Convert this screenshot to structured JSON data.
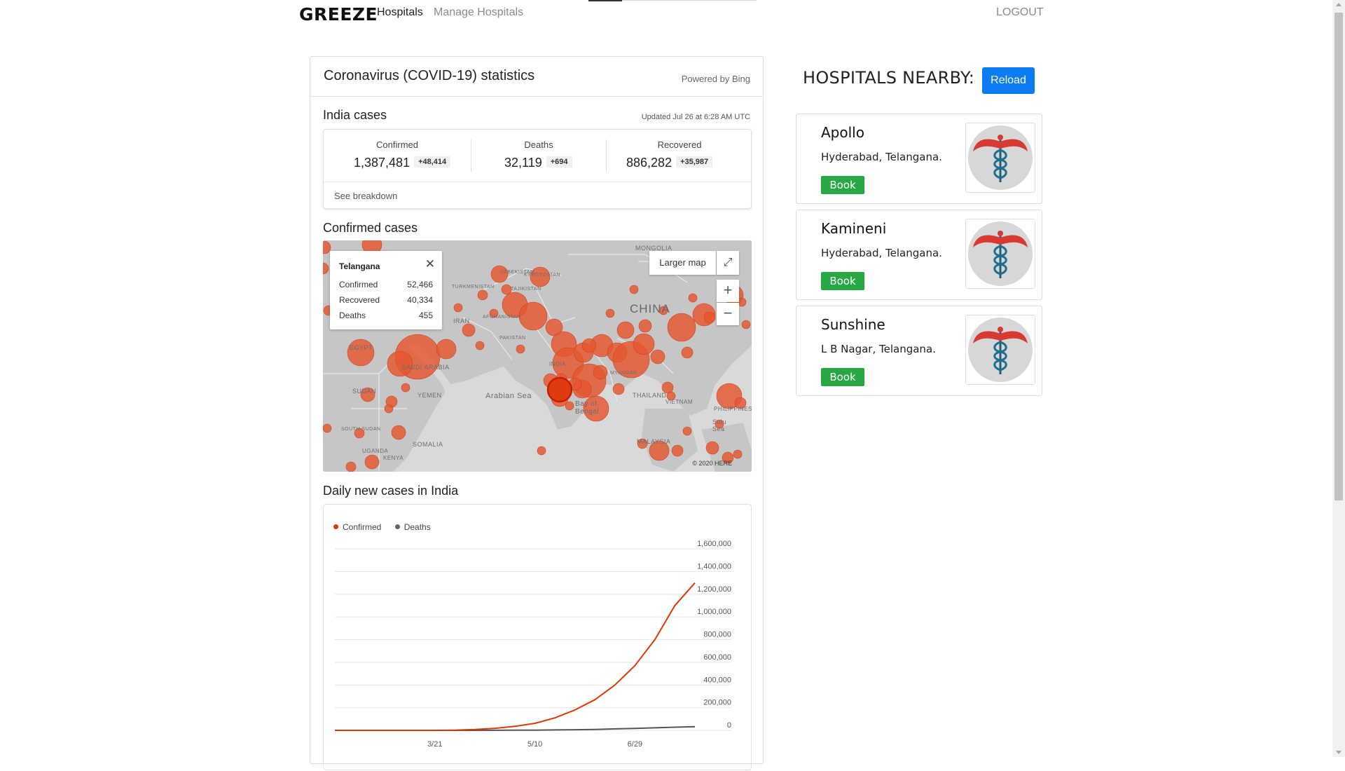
{
  "nav": {
    "brand": "GREEZE",
    "links": [
      "Hospitals",
      "Manage Hospitals"
    ],
    "logout": "LOGOUT"
  },
  "covid": {
    "title": "Coronavirus (COVID-19) statistics",
    "powered_by": "Powered by Bing",
    "india_cases_label": "India cases",
    "updated": "Updated Jul 26 at 6:28 AM UTC",
    "stats": [
      {
        "label": "Confirmed",
        "value": "1,387,481",
        "delta": "+48,414"
      },
      {
        "label": "Deaths",
        "value": "32,119",
        "delta": "+694"
      },
      {
        "label": "Recovered",
        "value": "886,282",
        "delta": "+35,987"
      }
    ],
    "see_breakdown": "See breakdown",
    "confirmed_cases_label": "Confirmed cases",
    "map": {
      "tooltip": {
        "title": "Telangana",
        "rows": [
          {
            "k": "Confirmed",
            "v": "52,466"
          },
          {
            "k": "Recovered",
            "v": "40,334"
          },
          {
            "k": "Deaths",
            "v": "455"
          }
        ]
      },
      "larger_map": "Larger map",
      "labels": [
        "MONGOLIA",
        "CHINA",
        "EGYPT",
        "SAUDI ARABIA",
        "SUDAN",
        "YEMEN",
        "Arabian Sea",
        "Bay of Bengal",
        "THAILAND",
        "VIETNAM",
        "PHILIPPINES",
        "Sulu Sea",
        "MALAYSIA",
        "SOMALIA",
        "SOUTH SUDAN",
        "UGANDA",
        "KENYA",
        "TURKMENISTAN",
        "UZBEKISTAN",
        "KYRGYZSTAN",
        "TAJIKISTAN",
        "AFGHANISTAN",
        "PAKISTAN",
        "IRAN",
        "MYANMAR",
        "INDIA"
      ],
      "copyright": "© 2020 HERE",
      "bubble_color": "#e4572e"
    },
    "daily_label": "Daily new cases in India"
  },
  "chart_data": {
    "type": "line",
    "title": "Daily new cases in India",
    "x": [
      "2/1",
      "2/11",
      "2/21",
      "3/2",
      "3/11",
      "3/21",
      "3/31",
      "4/10",
      "4/20",
      "4/30",
      "5/10",
      "5/20",
      "5/30",
      "6/9",
      "6/19",
      "6/29",
      "7/9",
      "7/19",
      "7/25"
    ],
    "xtick_labels": [
      "3/21",
      "5/10",
      "6/29"
    ],
    "xtick_positions": [
      "3/21",
      "5/10",
      "6/29"
    ],
    "ylim": [
      0,
      1600000
    ],
    "yticks": [
      0,
      200000,
      400000,
      600000,
      800000,
      1000000,
      1200000,
      1400000,
      1600000
    ],
    "ytick_labels": [
      "0",
      "200,000",
      "400,000",
      "600,000",
      "800,000",
      "1,000,000",
      "1,200,000",
      "1,400,000",
      "1,600,000"
    ],
    "series": [
      {
        "name": "Confirmed",
        "color": "#d93a00",
        "values": [
          0,
          0,
          0,
          5,
          60,
          300,
          1400,
          7500,
          18000,
          35000,
          62000,
          110000,
          180000,
          270000,
          400000,
          570000,
          800000,
          1100000,
          1300000
        ]
      },
      {
        "name": "Deaths",
        "color": "#555555",
        "values": [
          0,
          0,
          0,
          0,
          1,
          8,
          40,
          240,
          600,
          1100,
          2100,
          3400,
          5300,
          7700,
          12900,
          16900,
          22100,
          28000,
          32100
        ]
      }
    ],
    "legend_position": "top-left",
    "grid": true
  },
  "hospitals": {
    "title": "HOSPITALS NEARBY:",
    "reload": "Reload",
    "book_label": "Book",
    "logo_icon": "caduceus-icon",
    "items": [
      {
        "name": "Apollo",
        "address": "Hyderabad, Telangana."
      },
      {
        "name": "Kamineni",
        "address": "Hyderabad, Telangana."
      },
      {
        "name": "Sunshine",
        "address": "L B Nagar, Telangana."
      }
    ]
  }
}
